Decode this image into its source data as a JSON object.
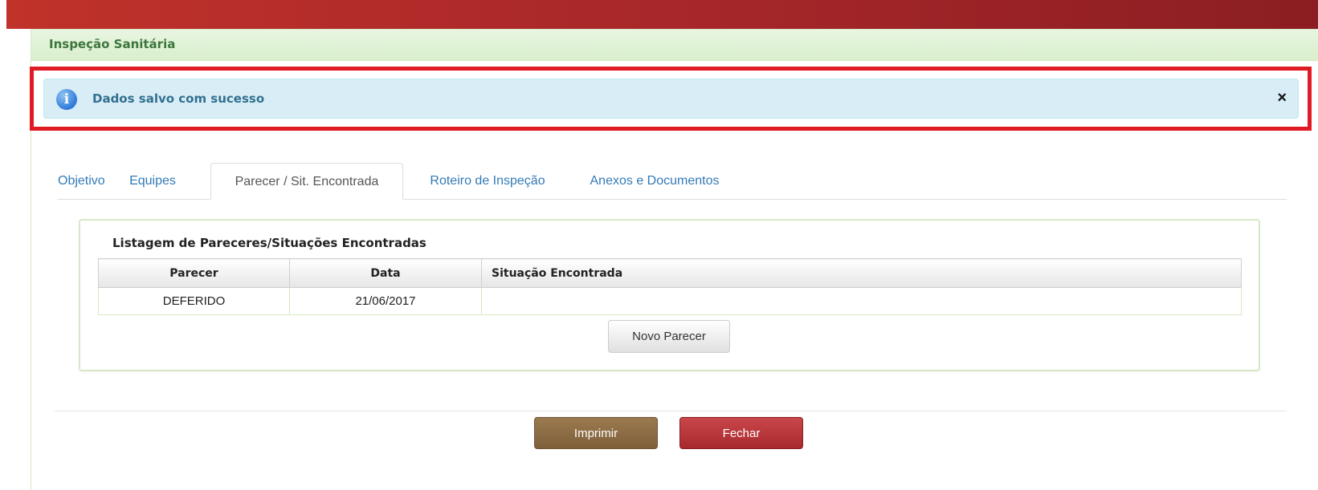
{
  "panel": {
    "title": "Inspeção Sanitária"
  },
  "alert": {
    "message": "Dados salvo com sucesso",
    "close_label": "×"
  },
  "tabs": [
    {
      "label": "Objetivo"
    },
    {
      "label": "Equipes"
    },
    {
      "label": "Parecer / Sit. Encontrada"
    },
    {
      "label": "Roteiro de Inspeção"
    },
    {
      "label": "Anexos e Documentos"
    }
  ],
  "listing": {
    "title": "Listagem de Pareceres/Situações Encontradas",
    "columns": [
      "Parecer",
      "Data",
      "Situação Encontrada"
    ],
    "rows": [
      [
        "DEFERIDO",
        "21/06/2017",
        ""
      ]
    ],
    "new_button": "Novo Parecer"
  },
  "footer": {
    "print_label": "Imprimir",
    "close_label": "Fechar"
  },
  "colors": {
    "topbar": "#a8272a",
    "panel_heading_text": "#3c763d",
    "alert_bg": "#d9edf7",
    "alert_text": "#31708f",
    "highlight_border": "#e01b24",
    "print_button": "#8b6a43",
    "close_button": "#b8373b"
  }
}
